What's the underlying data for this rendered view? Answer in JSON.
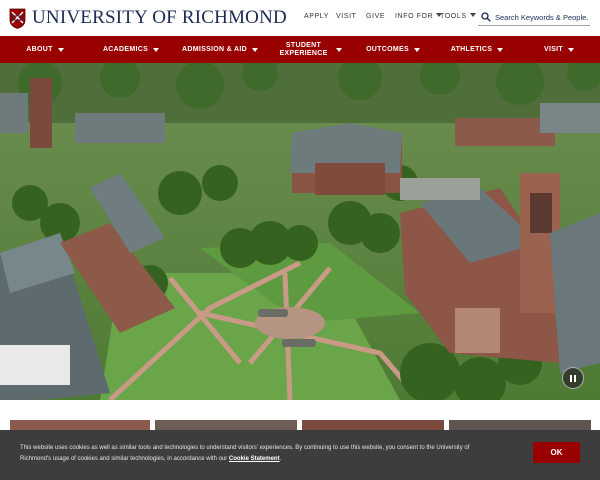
{
  "header": {
    "logo_text": "University of Richmond",
    "utility_links": [
      "APPLY",
      "VISIT",
      "GIVE",
      "INFO FOR",
      "TOOLS"
    ],
    "search_placeholder": "Search Keywords & People..."
  },
  "nav": {
    "items": [
      "ABOUT",
      "ACADEMICS",
      "ADMISSION & AID",
      "STUDENT EXPERIENCE",
      "OUTCOMES",
      "ATHLETICS",
      "VISIT"
    ]
  },
  "hero": {
    "image_alt_icon": "campus-aerial-photo",
    "pause_icon": "pause-icon"
  },
  "cookie": {
    "text": "This website uses cookies as well as similar tools and technologies to understand visitors' experiences. By continuing to use this website, you consent to the University of Richmond's usage of cookies and similar technologies, in accordance with our ",
    "link": "Cookie Statement",
    "end": ".",
    "ok_label": "OK"
  },
  "colors": {
    "brand_red": "#990000",
    "brand_navy": "#1a2b57",
    "banner_bg": "#3d3d3d"
  }
}
